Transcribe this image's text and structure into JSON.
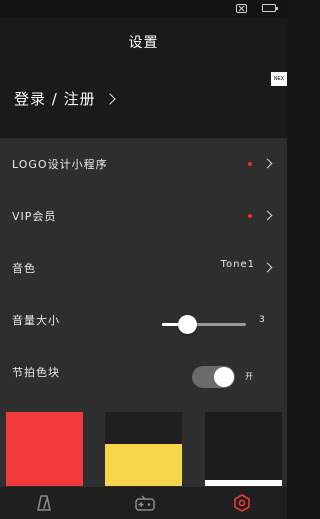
{
  "header": {
    "title": "设置",
    "login_label": "登录 / 注册",
    "next_badge": "NEX"
  },
  "rows": [
    {
      "label": "LOGO设计小程序",
      "has_dot": true,
      "has_chevron": true
    },
    {
      "label": "VIP会员",
      "has_dot": true,
      "has_chevron": true
    },
    {
      "label": "音色",
      "value": "Tone1",
      "has_chevron": true
    },
    {
      "label": "音量大小",
      "value": "3"
    },
    {
      "label": "节拍色块",
      "toggle_state": "开"
    }
  ],
  "volume": {
    "value": 3,
    "max": 10
  },
  "beat_color_toggle": {
    "on": true,
    "label": "开"
  },
  "colors": {
    "accent_red": "#f23a3a",
    "accent_yellow": "#f7d54a",
    "accent_white": "#ffffff",
    "active_tab": "#e6373a",
    "tab_inactive": "#9a9a9a"
  },
  "color_swatches": [
    {
      "name": "red",
      "color": "#f23a3a",
      "fill_fraction": 1.0
    },
    {
      "name": "yellow",
      "color": "#f7d54a",
      "fill_fraction": 0.57
    },
    {
      "name": "white",
      "color": "#ffffff",
      "fill_fraction": 0.08
    }
  ],
  "tabs": [
    {
      "icon": "metronome-icon",
      "active": false
    },
    {
      "icon": "gamepad-icon",
      "active": false
    },
    {
      "icon": "settings-hexagon-icon",
      "active": true
    }
  ]
}
